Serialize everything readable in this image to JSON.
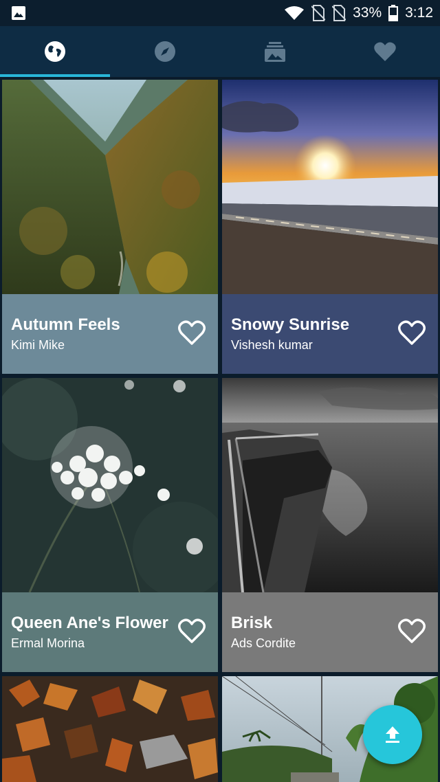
{
  "status_bar": {
    "battery": "33%",
    "time": "3:12",
    "icons": [
      "gallery-icon",
      "wifi-icon",
      "no-sim-icon",
      "no-sim-icon",
      "battery-icon"
    ]
  },
  "tabs": [
    {
      "icon": "globe-icon",
      "selected": true
    },
    {
      "icon": "compass-icon",
      "selected": false
    },
    {
      "icon": "collections-icon",
      "selected": false
    },
    {
      "icon": "heart-icon",
      "selected": false
    }
  ],
  "colors": {
    "tab_indicator": "#29b6d9",
    "fab": "#26c6da",
    "tabbar": "#0e2c44"
  },
  "wallpapers": [
    {
      "title": "Autumn Feels",
      "author": "Kimi Mike",
      "caption_color": "#6d8a99"
    },
    {
      "title": "Snowy Sunrise",
      "author": "Vishesh kumar",
      "caption_color": "#3b4a72"
    },
    {
      "title": "Queen Ane's Flower",
      "author": "Ermal Morina",
      "caption_color": "#5d7a7a"
    },
    {
      "title": "Brisk",
      "author": "Ads Cordite",
      "caption_color": "#7a7a7a"
    }
  ],
  "fab": {
    "icon": "upload-icon"
  }
}
